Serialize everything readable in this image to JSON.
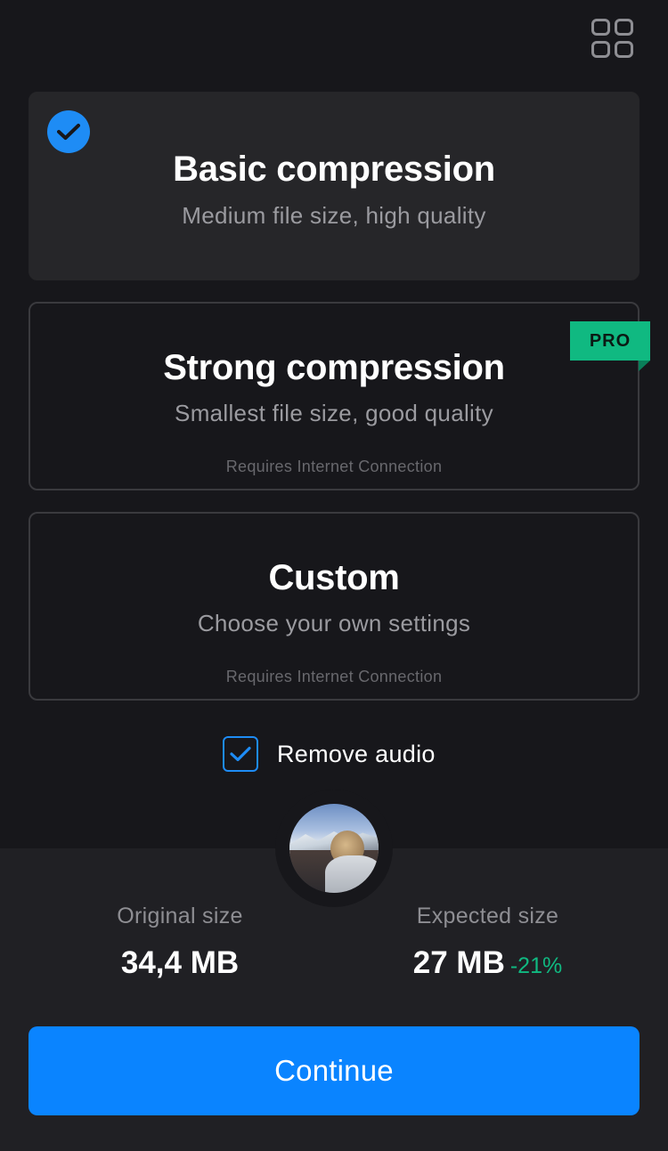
{
  "header": {
    "grid_icon": "grid-icon"
  },
  "options": [
    {
      "title": "Basic compression",
      "subtitle": "Medium file size, high quality",
      "selected": true
    },
    {
      "title": "Strong compression",
      "subtitle": "Smallest file size, good quality",
      "requirement": "Requires Internet Connection",
      "badge": "PRO"
    },
    {
      "title": "Custom",
      "subtitle": "Choose your own settings",
      "requirement": "Requires Internet Connection"
    }
  ],
  "remove_audio": {
    "label": "Remove audio",
    "checked": true
  },
  "stats": {
    "original_label": "Original size",
    "original_value": "34,4 MB",
    "expected_label": "Expected size",
    "expected_value": "27 MB",
    "expected_delta": "-21%"
  },
  "continue_label": "Continue",
  "colors": {
    "accent": "#0a84ff",
    "pro": "#10b981",
    "delta": "#10b981"
  }
}
